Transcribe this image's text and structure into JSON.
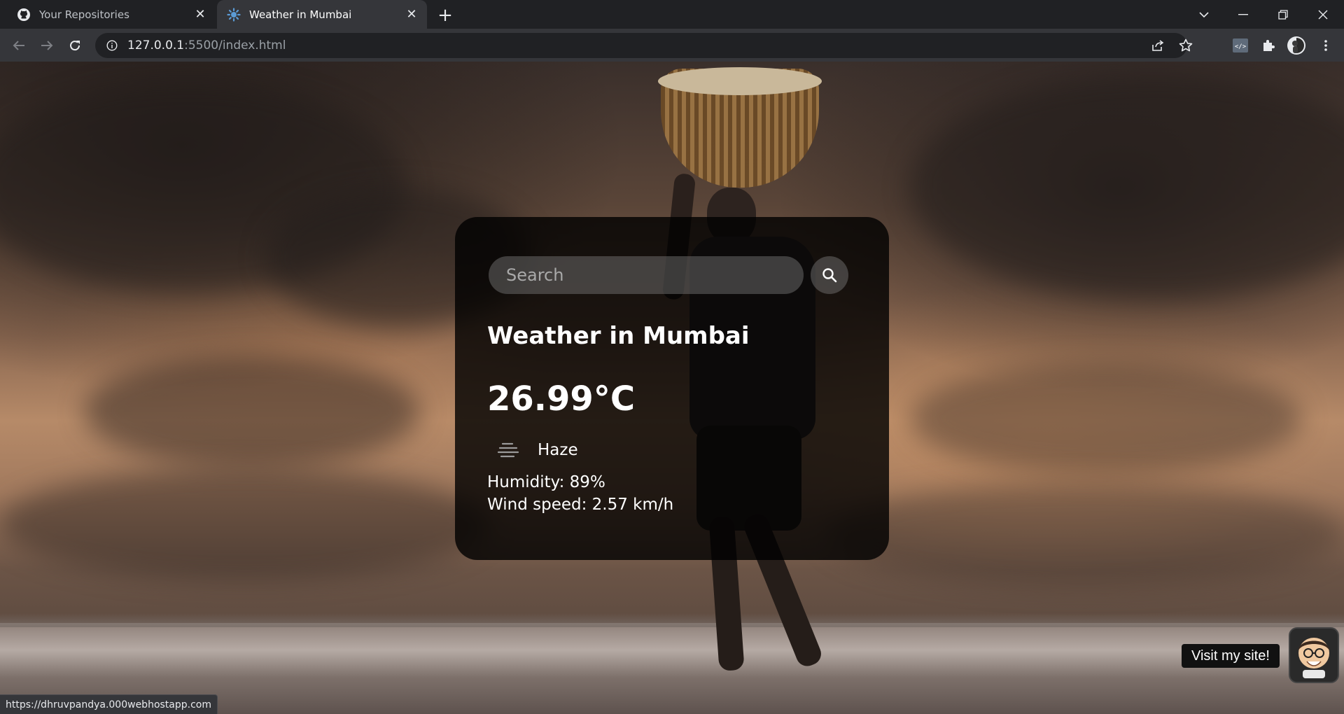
{
  "browser": {
    "tabs": [
      {
        "title": "Your Repositories",
        "active": false,
        "favicon": "github-icon"
      },
      {
        "title": "Weather in Mumbai",
        "active": true,
        "favicon": "weather-app-icon"
      }
    ],
    "address": {
      "host": "127.0.0.1",
      "rest": ":5500/index.html"
    },
    "status_url": "https://dhruvpandya.000webhostapp.com"
  },
  "weather": {
    "search_placeholder": "Search",
    "city_title": "Weather in Mumbai",
    "temperature": "26.99°C",
    "condition": "Haze",
    "condition_icon": "haze-icon",
    "humidity": "Humidity: 89%",
    "wind": "Wind speed: 2.57 km/h"
  },
  "promo": {
    "label": "Visit my site!"
  },
  "colors": {
    "card_bg": "#000000cc",
    "input_bg": "#7c7c7c73",
    "chrome_dark": "#202124",
    "chrome_toolbar": "#35363a"
  }
}
